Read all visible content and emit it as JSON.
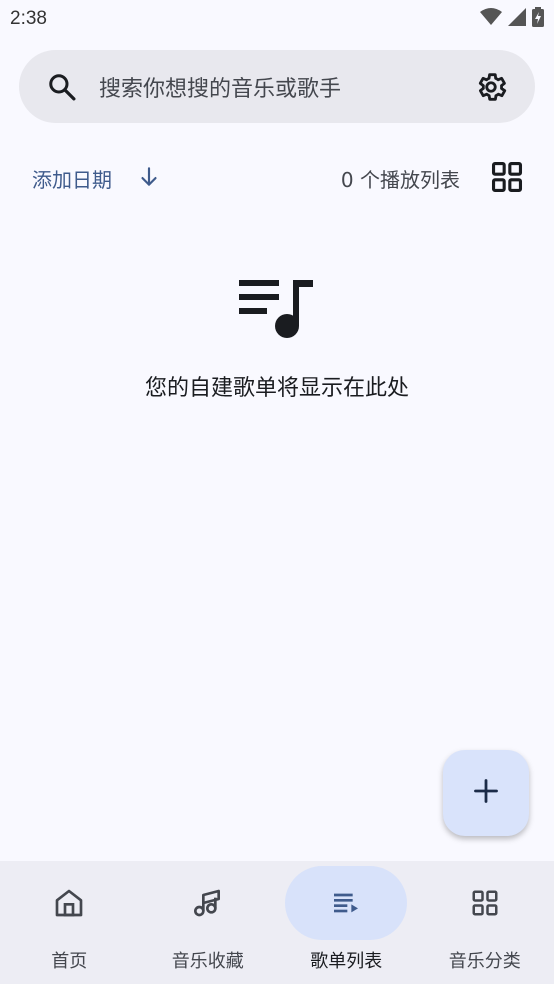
{
  "status_bar": {
    "time": "2:38",
    "icons": [
      "wifi-icon",
      "signal-icon",
      "battery-charging-icon"
    ]
  },
  "search": {
    "placeholder": "搜索你想搜的音乐或歌手",
    "leading_icon": "search-icon",
    "trailing_icon": "gear-icon"
  },
  "sort_bar": {
    "sort_label": "添加日期",
    "sort_direction_icon": "arrow-down-icon",
    "playlist_count": "0 个播放列表",
    "view_toggle_icon": "grid-view-icon"
  },
  "empty_state": {
    "icon": "playlist-music-icon",
    "message": "您的自建歌单将显示在此处"
  },
  "fab": {
    "icon": "plus-icon"
  },
  "bottom_nav": {
    "items": [
      {
        "label": "首页",
        "icon": "home-icon",
        "active": false
      },
      {
        "label": "音乐收藏",
        "icon": "music-note-icon",
        "active": false
      },
      {
        "label": "歌单列表",
        "icon": "playlist-icon",
        "active": true
      },
      {
        "label": "音乐分类",
        "icon": "category-grid-icon",
        "active": false
      }
    ]
  },
  "colors": {
    "background": "#f9f9ff",
    "accent": "#3f5b8c",
    "active_indicator": "#d8e2fa",
    "fab": "#d9e3fb",
    "nav_background": "#ededf4"
  }
}
